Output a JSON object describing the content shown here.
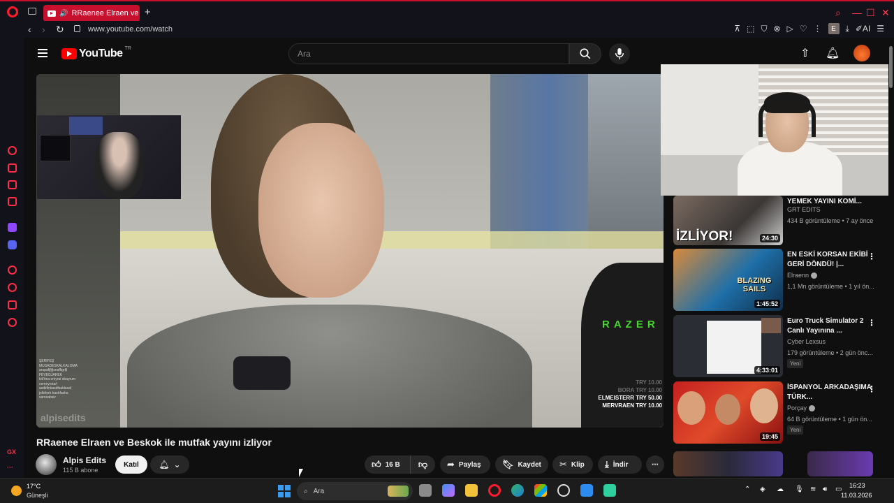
{
  "browser": {
    "tab_title": "RRaenee Elraen ve Bes",
    "url": "www.youtube.com/watch",
    "profile_letter": "E",
    "ai_label": "AI"
  },
  "youtube": {
    "logo_text": "YouTube",
    "region": "TR",
    "search_placeholder": "Ara"
  },
  "video": {
    "title": "RRaenee Elraen ve Beskok ile mutfak yayını izliyor",
    "overlay_watermark": "alpisedits",
    "overlay_brand": "RAZER",
    "donations": [
      "TRY 10.00",
      "BORA  TRY 10.00",
      "ELMEISTERR  TRY 50.00",
      "MERVRAEN  TRY 10.00"
    ],
    "chat_lines": [
      "ŞERIFEŞ",
      "MUSADESKALKALOMA",
      "arupafjfjfjsnaffigrfjl",
      "FEVEGJAHEK",
      "kik'tina eniyrai obayrum",
      "cemeyrotar!",
      "asdkfinkasdfsaklasaf",
      "jeltirlerk hashfasha",
      "sarnsabsiz"
    ],
    "channel": {
      "name": "Alpis Edits",
      "subs": "115 B abone",
      "join": "Katıl"
    },
    "actions": {
      "likes": "16 B",
      "share": "Paylaş",
      "save": "Kaydet",
      "clip": "Klip",
      "download": "İndir"
    }
  },
  "recommendations": [
    {
      "title": "YEMEK YAYINI KOMİ...",
      "channel": "GRT EDITS",
      "meta": "434 B görüntüleme • 7 ay önce",
      "duration": "24:30",
      "thumb_text": "İZLİYOR!",
      "verified": false,
      "new": ""
    },
    {
      "title": "EN ESKİ KORSAN EKİBİ GERİ DÖNDÜ! |...",
      "channel": "Elraenn",
      "meta": "1,1 Mn görüntüleme • 1 yıl ön...",
      "duration": "1:45:52",
      "thumb_text": "BLAZING SAILS",
      "verified": true,
      "new": ""
    },
    {
      "title": "Euro Truck Simulator 2 Canlı Yayınına ...",
      "channel": "Cyber Lexsus",
      "meta": "179 görüntüleme • 2 gün önc...",
      "duration": "4:33:01",
      "thumb_text": "",
      "verified": false,
      "new": "Yeni"
    },
    {
      "title": "İSPANYOL ARKADAŞIMA TÜRK...",
      "channel": "Porçay",
      "meta": "64 B görüntüleme • 1 gün ön...",
      "duration": "19:45",
      "thumb_text": "",
      "verified": true,
      "new": "Yeni"
    }
  ],
  "taskbar": {
    "temp": "17°C",
    "weather": "Güneşli",
    "search": "Ara",
    "time": "16:23",
    "date": "11.03.2026"
  },
  "colors": {
    "opera_red": "#c8102e",
    "yt_red": "#ff0000",
    "razer_green": "#44d62c"
  }
}
